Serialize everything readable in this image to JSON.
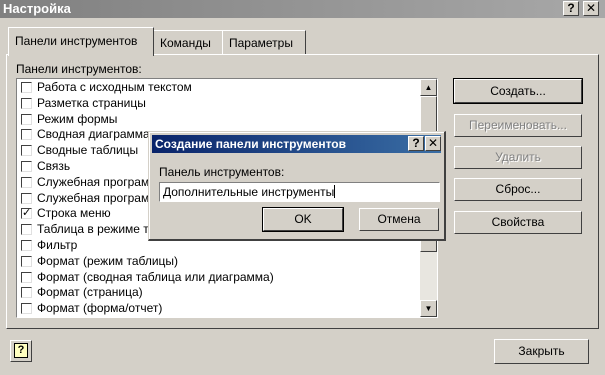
{
  "window": {
    "title": "Настройка",
    "help_label": "?",
    "close_label": "✕"
  },
  "tabs": [
    {
      "label": "Панели инструментов"
    },
    {
      "label": "Команды"
    },
    {
      "label": "Параметры"
    }
  ],
  "toolbars_label": "Панели инструментов:",
  "toolbars": [
    {
      "label": "Работа с исходным текстом",
      "checked": false
    },
    {
      "label": "Разметка страницы",
      "checked": false
    },
    {
      "label": "Режим формы",
      "checked": false
    },
    {
      "label": "Сводная диаграмма",
      "checked": false
    },
    {
      "label": "Сводные таблицы",
      "checked": false
    },
    {
      "label": "Связь",
      "checked": false
    },
    {
      "label": "Служебная програм",
      "checked": false
    },
    {
      "label": "Служебная програм",
      "checked": false
    },
    {
      "label": "Строка меню",
      "checked": true
    },
    {
      "label": "Таблица в режиме т",
      "checked": false
    },
    {
      "label": "Фильтр",
      "checked": false
    },
    {
      "label": "Формат (режим таблицы)",
      "checked": false
    },
    {
      "label": "Формат (сводная таблица или диаграмма)",
      "checked": false
    },
    {
      "label": "Формат (страница)",
      "checked": false
    },
    {
      "label": "Формат (форма/отчет)",
      "checked": false
    }
  ],
  "buttons": {
    "create": "Создать...",
    "rename": "Переименовать...",
    "delete": "Удалить",
    "reset": "Сброс...",
    "properties": "Свойства",
    "close": "Закрыть"
  },
  "modal": {
    "title": "Создание панели инструментов",
    "field_label": "Панель инструментов:",
    "field_value": "Дополнительные инструменты",
    "ok": "OK",
    "cancel": "Отмена",
    "help_label": "?",
    "close_label": "✕"
  },
  "scroll_arrows": {
    "up": "▲",
    "down": "▼"
  },
  "check_mark": "✓",
  "help_button_glyph": "?"
}
